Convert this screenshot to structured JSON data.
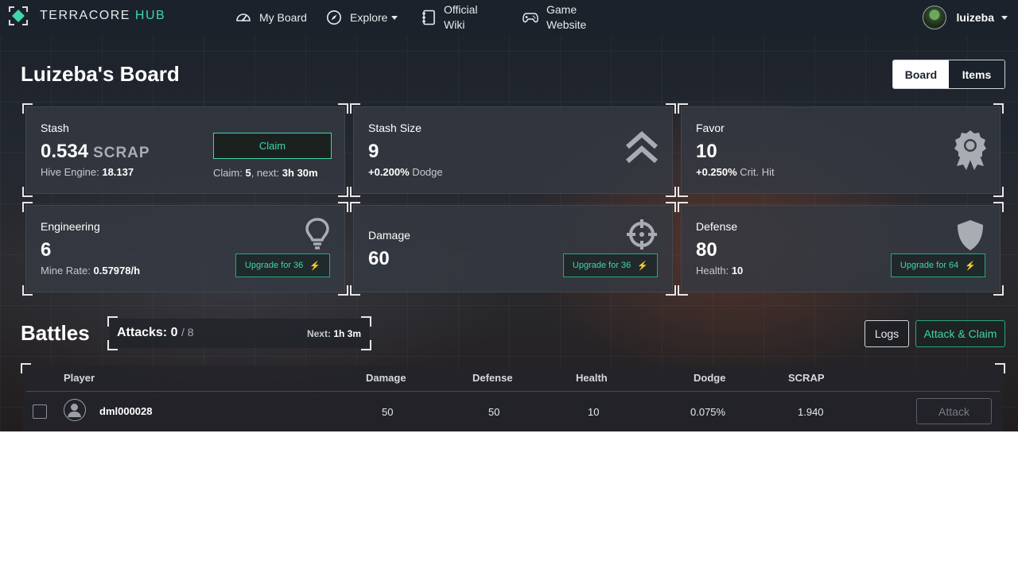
{
  "nav": {
    "brand_main": "TERRACORE",
    "brand_accent": " HUB",
    "items": [
      {
        "label": "My Board",
        "icon": "speedometer-icon"
      },
      {
        "label": "Explore",
        "icon": "compass-icon"
      },
      {
        "label": "Official Wiki",
        "icon": "journal-icon"
      },
      {
        "label": "Game Website",
        "icon": "gamepad-icon"
      }
    ],
    "user": "luizeba"
  },
  "page": {
    "title": "Luizeba's Board",
    "tabs": [
      "Board",
      "Items"
    ],
    "active_tab": "Board"
  },
  "cards": {
    "stash": {
      "label": "Stash",
      "value": "0.534",
      "unit": "SCRAP",
      "sub_label": "Hive Engine:",
      "sub_value": "18.137",
      "claim_button": "Claim",
      "claim_label": "Claim:",
      "claim_count": "5",
      "next_label": ", next:",
      "next_value": "3h 30m"
    },
    "stash_size": {
      "label": "Stash Size",
      "value": "9",
      "sub_value": "+0.200%",
      "sub_label": " Dodge",
      "icon": "chevrons-up-icon"
    },
    "favor": {
      "label": "Favor",
      "value": "10",
      "sub_value": "+0.250%",
      "sub_label": " Crit. Hit",
      "icon": "award-badge-icon"
    },
    "engineering": {
      "label": "Engineering",
      "value": "6",
      "sub_label": "Mine Rate:",
      "sub_value": "0.57978/h",
      "upgrade": "Upgrade for 36",
      "icon": "lightbulb-icon"
    },
    "damage": {
      "label": "Damage",
      "value": "60",
      "upgrade": "Upgrade for 36",
      "icon": "crosshair-icon"
    },
    "defense": {
      "label": "Defense",
      "value": "80",
      "sub_label": "Health:",
      "sub_value": "10",
      "upgrade": "Upgrade for 64",
      "icon": "shield-icon"
    }
  },
  "battles": {
    "title": "Battles",
    "attacks_label": "Attacks:",
    "attacks_value": "0",
    "attacks_max": "/ 8",
    "next_label": "Next:",
    "next_value": "1h 3m",
    "logs_button": "Logs",
    "attack_claim_button": "Attack & Claim",
    "columns": [
      "Player",
      "Damage",
      "Defense",
      "Health",
      "Dodge",
      "SCRAP"
    ],
    "rows": [
      {
        "player": "dml000028",
        "damage": "50",
        "defense": "50",
        "health": "10",
        "dodge": "0.075%",
        "scrap": "1.940",
        "action": "Attack"
      }
    ]
  },
  "colors": {
    "accent": "#3fd6a9",
    "nav_bg": "#1b222c",
    "card_bg": "#343942",
    "bolt": "#5b9ff0"
  }
}
